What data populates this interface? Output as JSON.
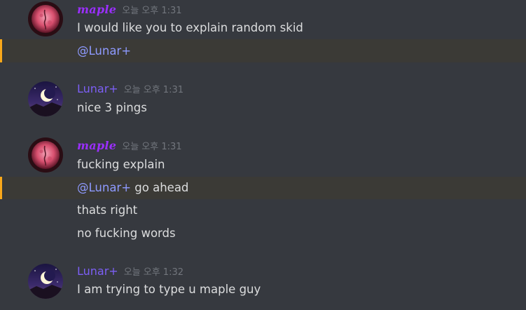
{
  "messages": [
    {
      "author": "maple",
      "timestamp": "오늘 오후 1:31",
      "avatar": "pink-moon-avatar",
      "lines": [
        {
          "mention": "",
          "text": "I would like you to explain random skid"
        },
        {
          "mention": "@Lunar+",
          "text": ""
        }
      ]
    },
    {
      "author": "Lunar+",
      "timestamp": "오늘 오후 1:31",
      "avatar": "crescent-moon-night-avatar",
      "lines": [
        {
          "mention": "",
          "text": "nice 3 pings"
        }
      ]
    },
    {
      "author": "maple",
      "timestamp": "오늘 오후 1:31",
      "avatar": "pink-moon-avatar",
      "lines": [
        {
          "mention": "",
          "text": "fucking explain"
        },
        {
          "mention": "@Lunar+",
          "text": " go ahead"
        },
        {
          "mention": "",
          "text": "thats right"
        },
        {
          "mention": "",
          "text": "no fucking words"
        }
      ]
    },
    {
      "author": "Lunar+",
      "timestamp": "오늘 오후 1:32",
      "avatar": "crescent-moon-night-avatar",
      "lines": [
        {
          "mention": "",
          "text": "I am trying to type u maple guy"
        }
      ]
    }
  ],
  "colors": {
    "background": "#36393f",
    "mention_highlight_bg": "#3b3a36",
    "mention_bar": "#faa81a",
    "maple_name": "#9b2fff",
    "lunar_name": "#7c5ff5",
    "ping_text": "#8e9aff",
    "message_text": "#dcddde",
    "timestamp": "#72767d"
  }
}
